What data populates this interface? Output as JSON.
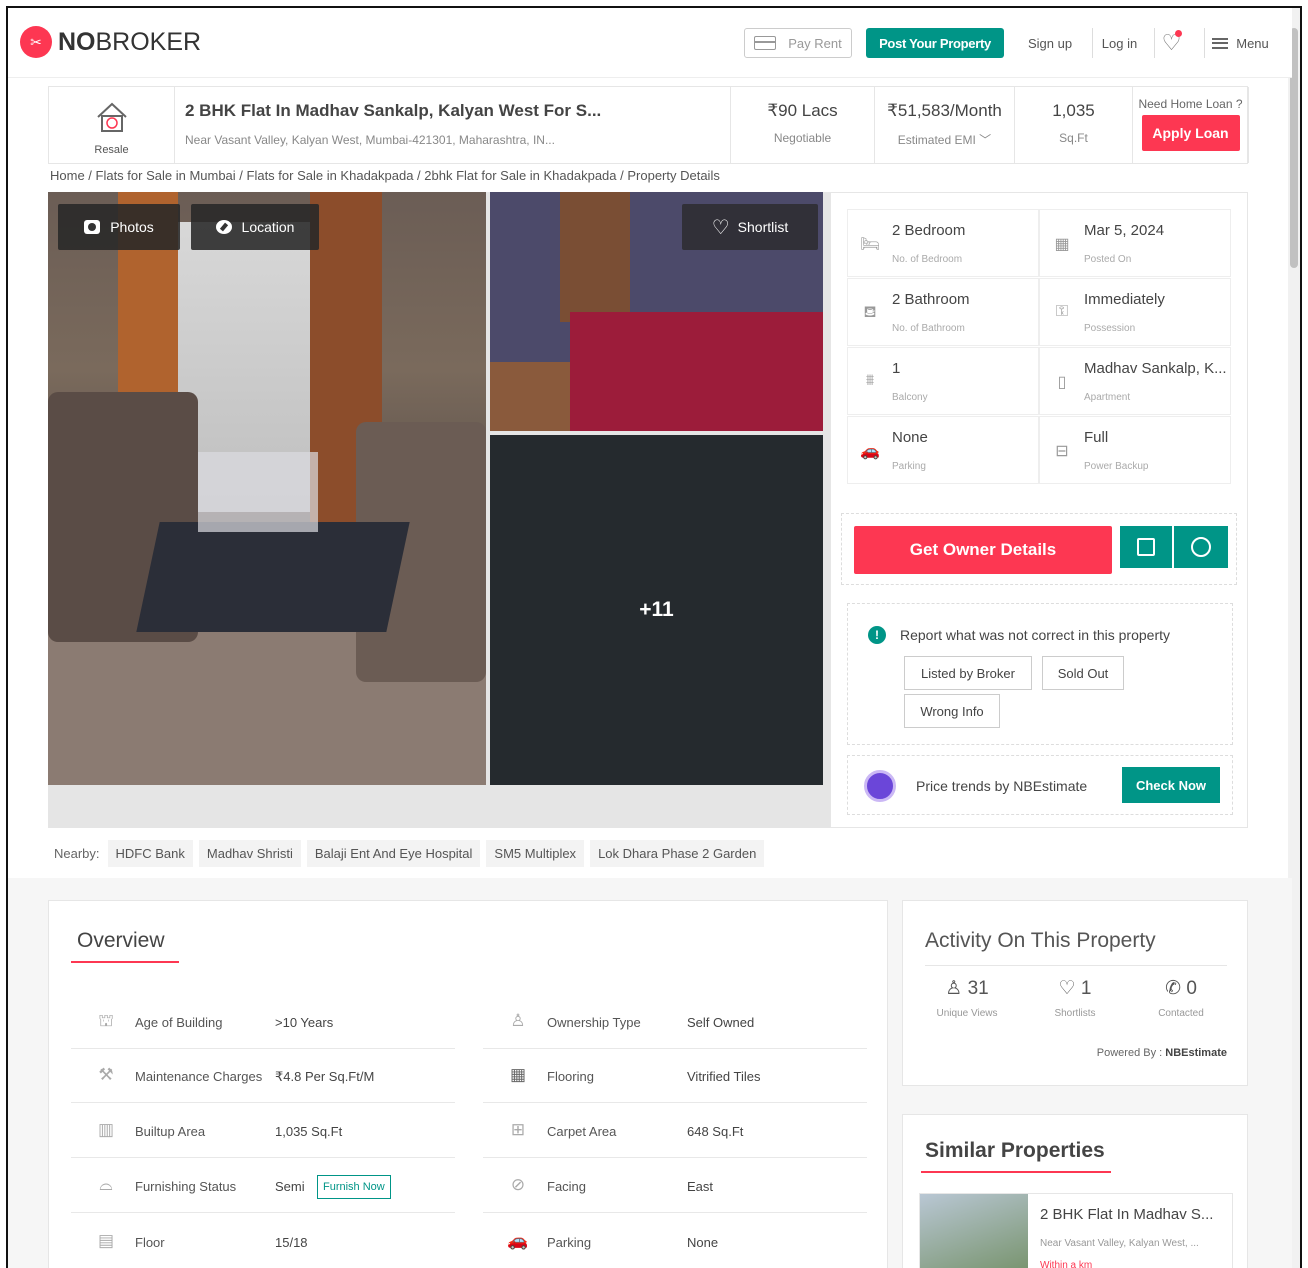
{
  "brand": {
    "logo_text_bold": "NO",
    "logo_text": "BROKER",
    "accent": "#fd3752",
    "teal": "#009587"
  },
  "header": {
    "pay_rent": "Pay Rent",
    "post_property": "Post Your Property",
    "sign_up": "Sign up",
    "log_in": "Log in",
    "menu": "Menu"
  },
  "property": {
    "type_label": "Resale",
    "title": "2 BHK Flat In Madhav Sankalp, Kalyan West For S...",
    "address": "Near Vasant Valley, Kalyan West, Mumbai-421301, Maharashtra, IN...",
    "price": "₹90 Lacs",
    "price_sub": "Negotiable",
    "emi": "₹51,583/Month",
    "emi_sub": "Estimated EMI",
    "area": "1,035",
    "area_sub": "Sq.Ft",
    "loan_q": "Need Home Loan ?",
    "loan_btn": "Apply Loan"
  },
  "breadcrumb": "Home / Flats for Sale in Mumbai / Flats for Sale in Khadakpada / 2bhk Flat for Sale in Khadakpada / Property Details",
  "gallery": {
    "photos": "Photos",
    "location": "Location",
    "shortlist": "Shortlist",
    "more": "+11"
  },
  "details": [
    {
      "value": "2 Bedroom",
      "key": "No. of Bedroom",
      "icon": "bed-icon"
    },
    {
      "value": "Mar 5, 2024",
      "key": "Posted On",
      "icon": "calendar-icon"
    },
    {
      "value": "2 Bathroom",
      "key": "No. of Bathroom",
      "icon": "bath-icon"
    },
    {
      "value": "Immediately",
      "key": "Possession",
      "icon": "key-icon"
    },
    {
      "value": "1",
      "key": "Balcony",
      "icon": "balcony-icon"
    },
    {
      "value": "Madhav Sankalp, K...",
      "key": "Apartment",
      "icon": "building-icon"
    },
    {
      "value": "None",
      "key": "Parking",
      "icon": "car-icon"
    },
    {
      "value": "Full",
      "key": "Power Backup",
      "icon": "battery-icon"
    }
  ],
  "actions": {
    "owner": "Get Owner Details"
  },
  "report": {
    "heading": "Report what was not correct in this property",
    "chips": [
      "Listed by Broker",
      "Sold Out",
      "Wrong Info"
    ]
  },
  "trend": {
    "text": "Price trends by NBEstimate",
    "button": "Check Now"
  },
  "nearby": {
    "label": "Nearby:",
    "tags": [
      "HDFC Bank",
      "Madhav Shristi",
      "Balaji Ent And Eye Hospital",
      "SM5 Multiplex",
      "Lok Dhara Phase 2 Garden"
    ]
  },
  "overview": {
    "heading": "Overview",
    "left": [
      {
        "key": "Age of Building",
        "value": ">10 Years",
        "icon": "building-age-icon"
      },
      {
        "key": "Maintenance Charges",
        "value": "₹4.8 Per Sq.Ft/M",
        "icon": "maintenance-icon"
      },
      {
        "key": "Builtup Area",
        "value": "1,035 Sq.Ft",
        "icon": "builtup-icon"
      },
      {
        "key": "Furnishing Status",
        "value": "Semi",
        "icon": "sofa-icon"
      },
      {
        "key": "Floor",
        "value": "15/18",
        "icon": "floor-icon"
      }
    ],
    "right": [
      {
        "key": "Ownership Type",
        "value": "Self Owned",
        "icon": "owner-icon"
      },
      {
        "key": "Flooring",
        "value": "Vitrified Tiles",
        "icon": "tiles-icon"
      },
      {
        "key": "Carpet Area",
        "value": "648 Sq.Ft",
        "icon": "carpet-icon"
      },
      {
        "key": "Facing",
        "value": "East",
        "icon": "compass-icon"
      },
      {
        "key": "Parking",
        "value": "None",
        "icon": "car-icon"
      }
    ],
    "furnish_now": "Furnish Now"
  },
  "activity": {
    "heading": "Activity On This Property",
    "views": "31",
    "views_label": "Unique Views",
    "shortlists": "1",
    "shortlists_label": "Shortlists",
    "contacted": "0",
    "contacted_label": "Contacted",
    "powered_label": "Powered By :",
    "powered_by": "NBEstimate"
  },
  "similar": {
    "heading": "Similar Properties",
    "title": "2 BHK Flat In Madhav S...",
    "address": "Near Vasant Valley, Kalyan West, ...",
    "distance": "Within a km"
  }
}
